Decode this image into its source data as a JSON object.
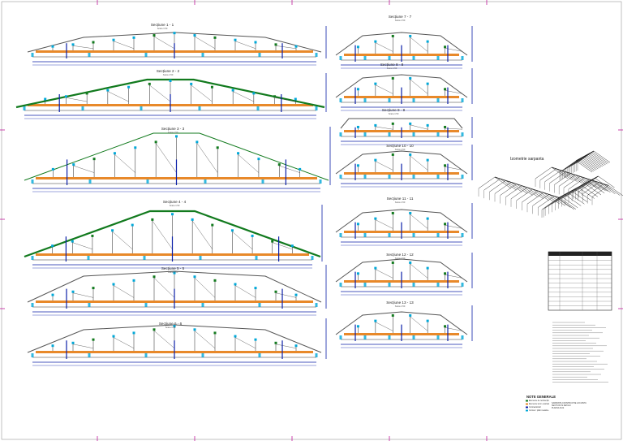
{
  "sections": [
    {
      "id": "s1",
      "title": "Secțiune 1 - 1",
      "scale": "Scara 1:50",
      "roof": "low"
    },
    {
      "id": "s2",
      "title": "Secțiune 2 - 2",
      "scale": "Scara 1:50",
      "roof": "steep"
    },
    {
      "id": "s3",
      "title": "Secțiune 3 - 3",
      "scale": "Scara 1:50",
      "roof": "tall"
    },
    {
      "id": "s4",
      "title": "Secțiune 4 - 4",
      "scale": "Scara 1:50",
      "roof": "steep"
    },
    {
      "id": "s5",
      "title": "Secțiune 5 - 5",
      "scale": "Scara 1:50",
      "roof": "low"
    },
    {
      "id": "s6",
      "title": "Secțiune 6 - 6",
      "scale": "Scara 1:50",
      "roof": "low"
    },
    {
      "id": "s7",
      "title": "Secțiune 7 - 7",
      "scale": "Scara 1:50",
      "roof": "small"
    },
    {
      "id": "s8",
      "title": "Secțiune 8 - 8",
      "scale": "Scara 1:50",
      "roof": "small"
    },
    {
      "id": "s9",
      "title": "Secțiune 9 - 9",
      "scale": "Scara 1:50",
      "roof": "flat"
    },
    {
      "id": "s10",
      "title": "Secțiune 10 - 10",
      "scale": "Scara 1:50",
      "roof": "small"
    },
    {
      "id": "s11",
      "title": "Secțiune 11 - 11",
      "scale": "Scara 1:50",
      "roof": "small"
    },
    {
      "id": "s12",
      "title": "Secțiune 12 - 12",
      "scale": "Scara 1:50",
      "roof": "small"
    },
    {
      "id": "s13",
      "title": "Secțiune 13 - 13",
      "scale": "Scara 1:50",
      "roof": "small"
    }
  ],
  "isometric_title": "Izometrie sarpanta",
  "legend": {
    "title": "NOTE GENERALE",
    "items": [
      "Elemente de rezistență",
      "Elemente lemn ecarisat",
      "Contravântuiri",
      "Cornier / plăci metalice"
    ]
  },
  "colors": {
    "timber": "#e8892a",
    "wall": "#0b1fa8",
    "roof": "#127a1e",
    "accent": "#00a8d8",
    "magenta": "#c0189b",
    "frame": "#222222"
  },
  "title_block": {
    "line1": "SARPANTA CONSTRUCTIE LOCUINTA",
    "line2": "SECTIUNI SI DETALII",
    "line3": "PLANSA R-02"
  }
}
